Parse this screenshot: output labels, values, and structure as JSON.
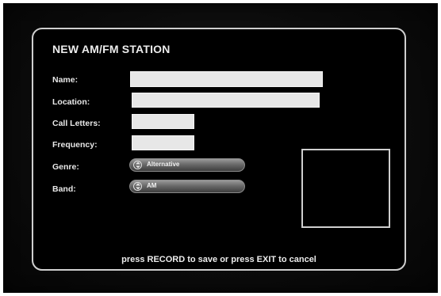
{
  "form": {
    "title": "NEW AM/FM STATION",
    "name_label": "Name:",
    "name_value": "",
    "location_label": "Location:",
    "location_value": "",
    "call_letters_label": "Call Letters:",
    "call_letters_value": "",
    "frequency_label": "Frequency:",
    "frequency_value": "",
    "genre_label": "Genre:",
    "genre_value": "Alternative",
    "band_label": "Band:",
    "band_value": "AM",
    "instruction": "press RECORD to save or press EXIT to cancel"
  },
  "icons": {
    "select_arrows": "up-down-arrows-icon"
  },
  "colors": {
    "background": "#000000",
    "panel_border": "#cfcfcf",
    "field_fill": "#e7e7e7",
    "text": "#ececec"
  }
}
